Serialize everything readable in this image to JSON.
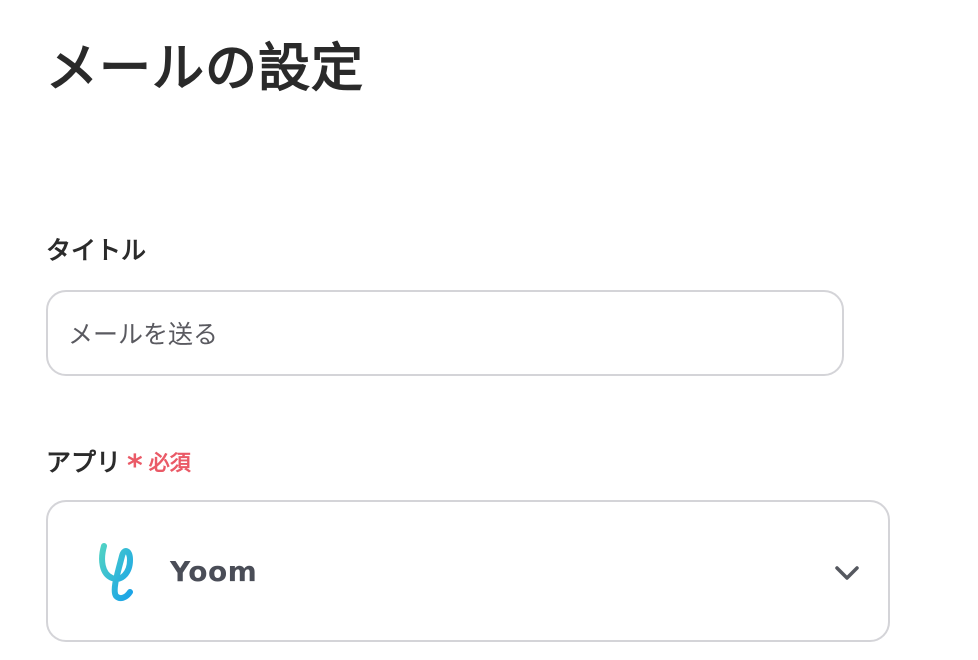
{
  "header": {
    "title": "メールの設定"
  },
  "form": {
    "title_field": {
      "label": "タイトル",
      "value": "メールを送る"
    },
    "app_field": {
      "label": "アプリ",
      "required_mark": "*",
      "required_text": "必須",
      "selected_value": "Yoom",
      "icon": "yoom-logo",
      "dropdown_icon": "chevron-down-icon"
    }
  },
  "colors": {
    "required": "#ea5a67",
    "border": "#d4d4d8",
    "logo_start": "#4fd1c5",
    "logo_end": "#1aa3e8"
  }
}
